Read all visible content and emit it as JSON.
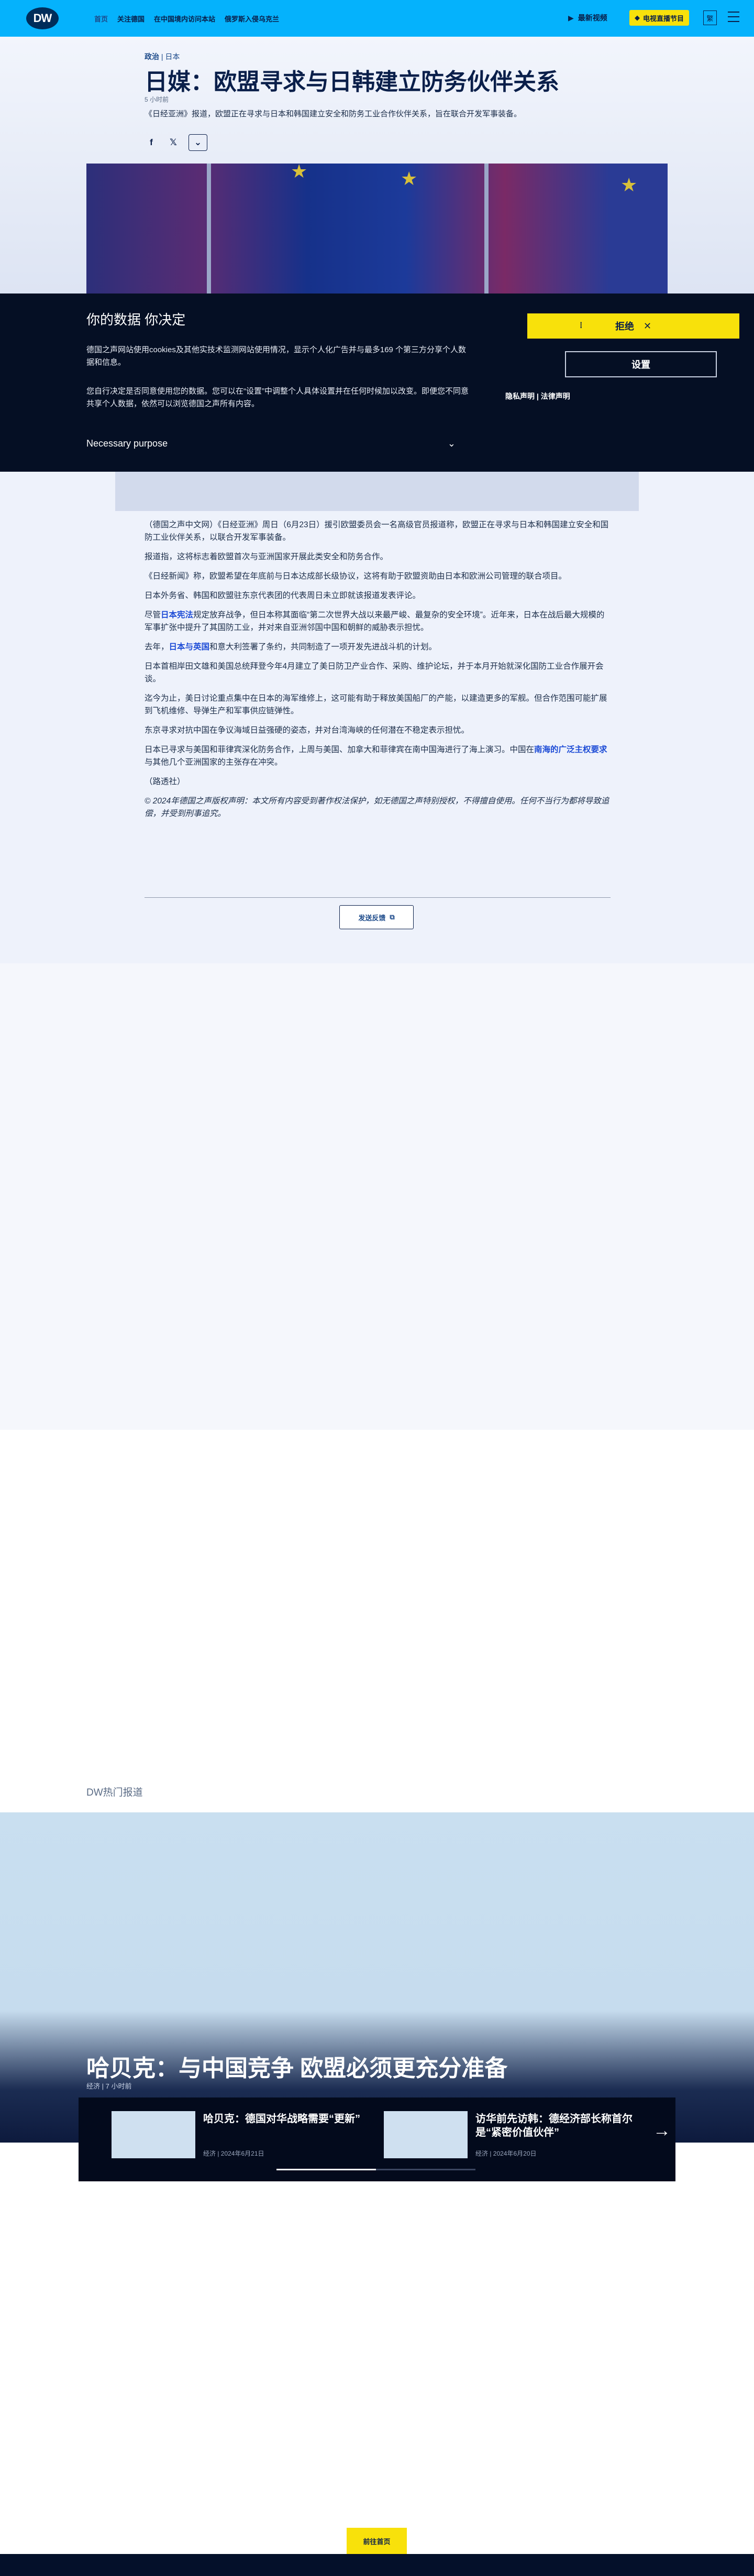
{
  "header": {
    "logo": "DW",
    "nav": [
      "首页",
      "关注德国",
      "在中国境内访问本站",
      "俄罗斯入侵乌克兰"
    ],
    "latest_video": "最新视频",
    "live": "电视直播节目",
    "lang": "繁"
  },
  "article": {
    "category": "政治",
    "subcategory": "日本",
    "title": "日媒：欧盟寻求与日韩建立防务伙伴关系",
    "time": "5 小时前",
    "teaser": "《日经亚洲》报道，欧盟正在寻求与日本和韩国建立安全和防务工业合作伙伴关系，旨在联合开发军事装备。",
    "share_icons": [
      "facebook-icon",
      "x-icon"
    ],
    "paragraphs": [
      "（德国之声中文网）《日经亚洲》周日（6月23日）援引欧盟委员会一名高级官员报道称，欧盟正在寻求与日本和韩国建立安全和国防工业伙伴关系，以联合开发军事装备。",
      "报道指，这将标志着欧盟首次与亚洲国家开展此类安全和防务合作。",
      "《日经新闻》称，欧盟希望在年底前与日本达成部长级协议，这将有助于欧盟资助由日本和欧洲公司管理的联合项目。",
      "日本外务省、韩国和欧盟驻东京代表团的代表周日未立即就该报道发表评论。"
    ],
    "p5": {
      "a": "尽管",
      "link": "日本宪法",
      "b": "规定放弃战争，但日本称其面临“第二次世界大战以来最严峻、最复杂的安全环境”。近年来，日本在战后最大规模的军事扩张中提升了其国防工业，并对来自亚洲邻国中国和朝鲜的威胁表示担忧。"
    },
    "p6": {
      "a": "去年，",
      "link": "日本与英国",
      "b": "和意大利签署了条约，共同制造了一项开发先进战斗机的计划。"
    },
    "paragraphs2": [
      "日本首相岸田文雄和美国总统拜登今年4月建立了美日防卫产业合作、采购、维护论坛，并于本月开始就深化国防工业合作展开会谈。",
      "迄今为止，美日讨论重点集中在日本的海军维修上，这可能有助于释放美国船厂的产能，以建造更多的军舰。但合作范围可能扩展到飞机维修、导弹生产和军事供应链弹性。",
      "东京寻求对抗中国在争议海域日益强硬的姿态，并对台湾海峡的任何潜在不稳定表示担忧。"
    ],
    "p10": {
      "a": "日本已寻求与美国和菲律宾深化防务合作，上周与美国、加拿大和菲律宾在南中国海进行了海上演习。中国在",
      "link": "南海的广泛主权要求",
      "b": "与其他几个亚洲国家的主张存在冲突。"
    },
    "source": "（路透社）",
    "copyright": "© 2024年德国之声版权声明：本文所有内容受到著作权法保护，如无德国之声特别授权，不得擅自使用。任何不当行为都将导致追偿，并受到刑事追究。",
    "feedback": "发送反馈"
  },
  "cookie": {
    "title": "你的数据 你决定",
    "p1": "德国之声网站使用cookies及其他实技术监测网站使用情况，显示个人化广告并与最多169 个第三方分享个人数据和信息。",
    "p2": "您自行决定是否同意使用您的数据。您可以在“设置”中调整个人具体设置并在任何时候加以改变。即便您不同意共享个人数据，依然可以浏览德国之声所有内容。",
    "purpose": "Necessary purpose",
    "reject": "拒绝",
    "settings": "设置",
    "privacy": "隐私声明",
    "legal": "法律声明"
  },
  "hot": {
    "title": "DW热门报道",
    "feature_title": "哈贝克：与中国竞争 欧盟必须更充分准备",
    "feature_meta": "经济 | 7 小时前",
    "cards": [
      {
        "title": "哈贝克：德国对华战略需要“更新”",
        "meta": "经济 | 2024年6月21日"
      },
      {
        "title": "访华前先访韩：德经济部长称首尔是“紧密价值伙伴”",
        "meta": "经济 | 2024年6月20日"
      }
    ]
  },
  "footer": {
    "back_to_top": "前往首页"
  }
}
